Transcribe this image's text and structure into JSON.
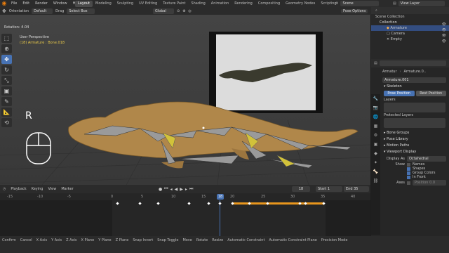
{
  "menu": [
    "File",
    "Edit",
    "Render",
    "Window",
    "Help"
  ],
  "workspaces": [
    "Layout",
    "Modeling",
    "Sculpting",
    "UV Editing",
    "Texture Paint",
    "Shading",
    "Animation",
    "Rendering",
    "Compositing",
    "Geometry Nodes",
    "Scripting"
  ],
  "scene": "Scene",
  "view_layer": "View Layer",
  "header2": {
    "orientation_label": "Orientation",
    "orientation_val": "Default",
    "drag_label": "Drag",
    "drag_val": "Select Box",
    "transform": "Global",
    "pose_options": "Pose Options"
  },
  "viewport": {
    "rotation": "Rotation: 4.04",
    "view_name": "User Perspective",
    "object_info": "(18) Armature : Bone.018",
    "key_hint": "R"
  },
  "outliner": {
    "title": "Scene Collection",
    "items": [
      {
        "label": "Collection"
      },
      {
        "label": "Armature"
      },
      {
        "label": "Camera"
      },
      {
        "label": "Empty"
      }
    ]
  },
  "props": {
    "armature_name": "Armatur",
    "armature_data": "Armature.0..",
    "data_field": "Armature.001",
    "skeleton": "Skeleton",
    "pose_position": "Pose Position",
    "rest_position": "Rest Position",
    "layers": "Layers",
    "protected_layers": "Protected Layers",
    "bone_groups": "Bone Groups",
    "pose_library": "Pose Library",
    "motion_paths": "Motion Paths",
    "viewport_display": "Viewport Display",
    "display_as_label": "Display As",
    "display_as_val": "Octahedral",
    "show_label": "Show",
    "names": "Names",
    "shapes": "Shapes",
    "group_colors": "Group Colors",
    "in_front": "In Front",
    "axes": "Axes",
    "position": "Position",
    "pos_val": "0.0"
  },
  "timeline": {
    "menus": [
      "Playback",
      "Keying",
      "View",
      "Marker"
    ],
    "current_frame": "18",
    "start_label": "Start",
    "start": "1",
    "end_label": "End",
    "end": "35",
    "ticks": [
      "-15",
      "-10",
      "-5",
      "0",
      "5",
      "10",
      "15",
      "20",
      "25",
      "30",
      "35",
      "40"
    ],
    "cursor": "18"
  },
  "status": [
    "Confirm",
    "Cancel",
    "X Axis",
    "Y Axis",
    "Z Axis",
    "X Plane",
    "Y Plane",
    "Z Plane",
    "Snap Invert",
    "Snap Toggle",
    "Move",
    "Rotate",
    "Resize",
    "Automatic Constraint",
    "Automatic Constraint Plane",
    "Precision Mode"
  ]
}
